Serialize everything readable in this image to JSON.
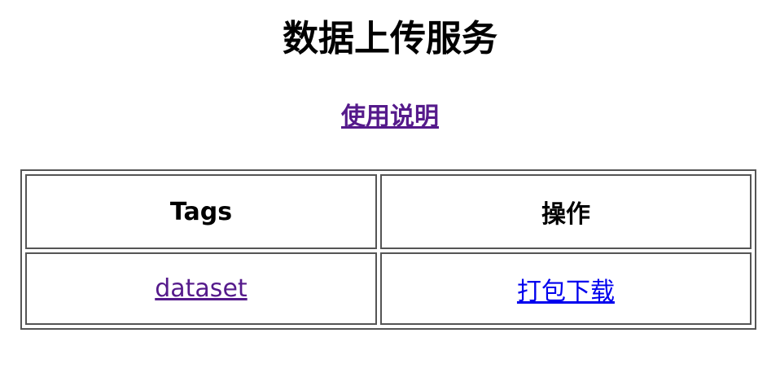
{
  "page": {
    "title": "数据上传服务",
    "instructions_link": "使用说明"
  },
  "table": {
    "headers": [
      "Tags",
      "操作"
    ],
    "rows": [
      {
        "tag": "dataset",
        "action": "打包下载"
      }
    ]
  },
  "colors": {
    "visited_link": "#551a8b",
    "unvisited_link": "#0000ee",
    "table_border": "#555555"
  }
}
